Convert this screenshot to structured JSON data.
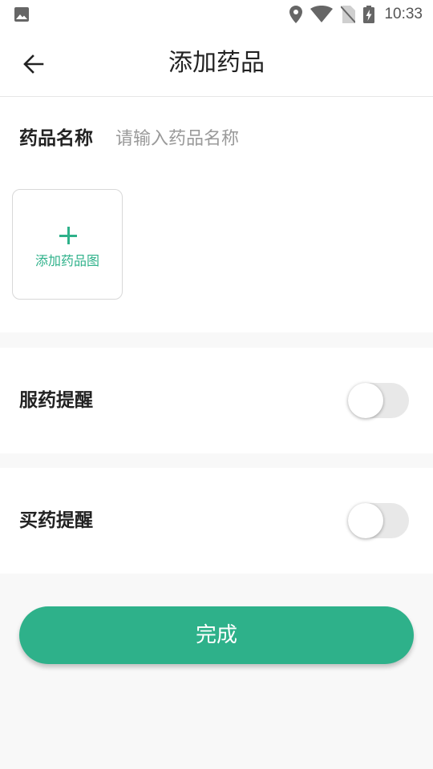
{
  "status_bar": {
    "time": "10:33",
    "icons": [
      "image-icon",
      "location-icon",
      "wifi-icon",
      "no-sim-icon",
      "battery-charging-icon"
    ]
  },
  "header": {
    "title": "添加药品",
    "back_icon": "arrow-left-icon"
  },
  "form": {
    "name_label": "药品名称",
    "name_placeholder": "请输入药品名称",
    "name_value": "",
    "add_image_label": "添加药品图"
  },
  "reminders": {
    "take_medicine": {
      "label": "服药提醒",
      "enabled": false
    },
    "buy_medicine": {
      "label": "买药提醒",
      "enabled": false
    }
  },
  "actions": {
    "done_label": "完成"
  },
  "colors": {
    "accent": "#2eb18a",
    "background": "#f8f8f8",
    "card": "#ffffff",
    "toggle_off_track": "#e8e8e8"
  }
}
